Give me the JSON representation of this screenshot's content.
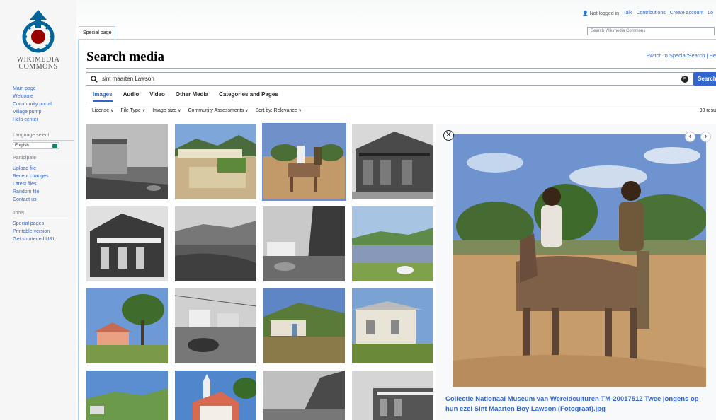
{
  "logo": {
    "line1": "WIKIMEDIA",
    "line2": "COMMONS"
  },
  "sidebar": {
    "main_links": [
      "Main page",
      "Welcome",
      "Community portal",
      "Village pump",
      "Help center"
    ],
    "language_heading": "Language select",
    "language_value": "English",
    "participate_heading": "Participate",
    "participate_links": [
      "Upload file",
      "Recent changes",
      "Latest files",
      "Random file",
      "Contact us"
    ],
    "tools_heading": "Tools",
    "tools_links": [
      "Special pages",
      "Printable version",
      "Get shortened URL"
    ]
  },
  "topbar": {
    "not_logged_in": "Not logged in",
    "talk": "Talk",
    "contributions": "Contributions",
    "create_account": "Create account",
    "login": "Lo",
    "special_tab": "Special page",
    "search_placeholder": "Search Wikimedia Commons"
  },
  "page": {
    "title": "Search media",
    "switch_link": "Switch to Special:Search | He"
  },
  "search": {
    "value": "sint maarten Lawson",
    "button": "Search"
  },
  "tabs": [
    "Images",
    "Audio",
    "Video",
    "Other Media",
    "Categories and Pages"
  ],
  "filters": [
    "License",
    "File Type",
    "Image size",
    "Community Assessments",
    "Sort by: Relevance"
  ],
  "results_count": "90 resu",
  "detail": {
    "caption": "Collectie Nationaal Museum van Wereldculturen TM-20017512 Twee jongens op hun ezel Sint Maarten Boy Lawson (Fotograaf).jpg"
  },
  "colors": {
    "link": "#3366cc",
    "accent": "#3366cc",
    "sidebar_bg": "#f6f6f6"
  }
}
